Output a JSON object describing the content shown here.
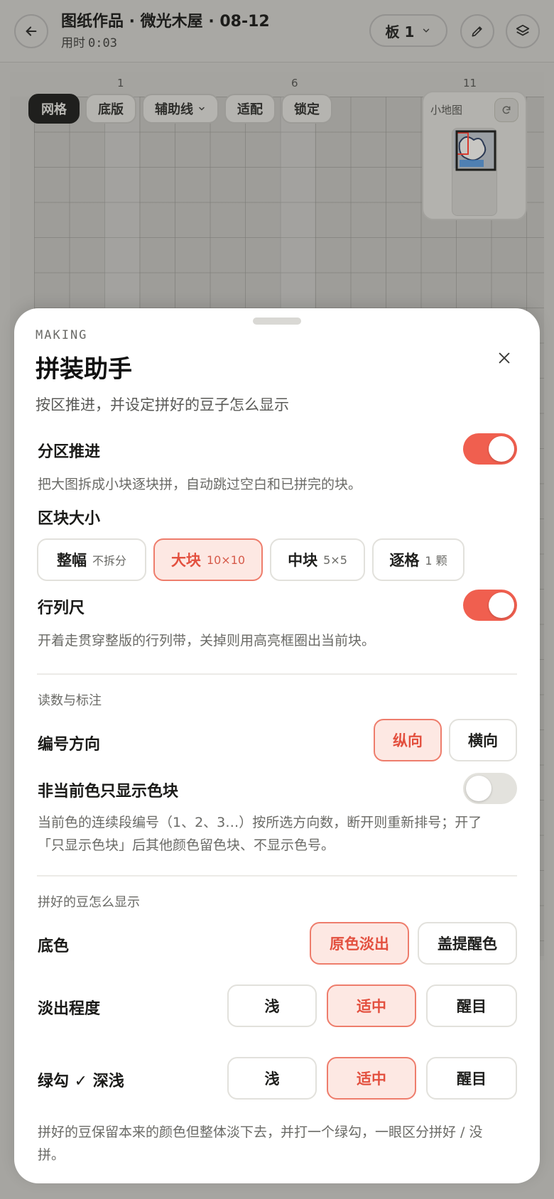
{
  "header": {
    "title": "图纸作品 · 微光木屋 · 08-12",
    "elapsed_label": "用时",
    "elapsed_time": "0:03",
    "board_label": "板 1",
    "icons": [
      "arrow-left-icon",
      "chevron-down-icon",
      "pencil-icon",
      "layers-icon"
    ]
  },
  "canvas": {
    "ruler_numbers": [
      "1",
      "6",
      "11"
    ],
    "toolbar": [
      {
        "label": "网格",
        "active": true
      },
      {
        "label": "底版",
        "active": false
      },
      {
        "label": "辅助线",
        "active": false,
        "has_dropdown": true
      },
      {
        "label": "适配",
        "active": false
      },
      {
        "label": "锁定",
        "active": false
      }
    ],
    "minimap": {
      "title": "小地图",
      "icon": "refresh-icon"
    }
  },
  "sheet": {
    "eyebrow": "MAKING",
    "title": "拼装助手",
    "subtitle": "按区推进，并设定拼好的豆子怎么显示",
    "zone_progress": {
      "label": "分区推进",
      "on": true,
      "desc": "把大图拆成小块逐块拼，自动跳过空白和已拼完的块。"
    },
    "block_size": {
      "label": "区块大小",
      "options": [
        {
          "main": "整幅",
          "sub": "不拆分",
          "selected": false
        },
        {
          "main": "大块",
          "sub": "10×10",
          "selected": true
        },
        {
          "main": "中块",
          "sub": "5×5",
          "selected": false
        },
        {
          "main": "逐格",
          "sub": "1 颗",
          "selected": false
        }
      ]
    },
    "ruler": {
      "label": "行列尺",
      "on": true,
      "desc": "开着走贯穿整版的行列带，关掉则用高亮框圈出当前块。"
    },
    "reading": {
      "section": "读数与标注",
      "numbering": {
        "label": "编号方向",
        "options": [
          "纵向",
          "横向"
        ],
        "selected": 0
      },
      "blocks_only": {
        "label": "非当前色只显示色块",
        "on": false,
        "desc1": "当前色的连续段编号（1、2、3…）按所选方向数，断开则重新排号；开了",
        "desc2": "「只显示色块」后其他颜色留色块、不显示色号。"
      }
    },
    "done_display": {
      "section": "拼好的豆怎么显示",
      "base": {
        "label": "底色",
        "options": [
          "原色淡出",
          "盖提醒色"
        ],
        "selected": 0
      },
      "fade": {
        "label": "淡出程度",
        "options": [
          "浅",
          "适中",
          "醒目"
        ],
        "selected": 1
      },
      "check": {
        "label": "绿勾 ✓ 深浅",
        "options": [
          "浅",
          "适中",
          "醒目"
        ],
        "selected": 1
      },
      "desc1": "拼好的豆保留本来的颜色但整体淡下去，并打一个绿勾，一眼区分拼好 / 没",
      "desc2": "拼。"
    }
  },
  "colors": {
    "accent": "#f05f4f",
    "selected_bg": "#fde8e3",
    "selected_border": "#ee7d6c",
    "selected_text": "#e3503f"
  }
}
